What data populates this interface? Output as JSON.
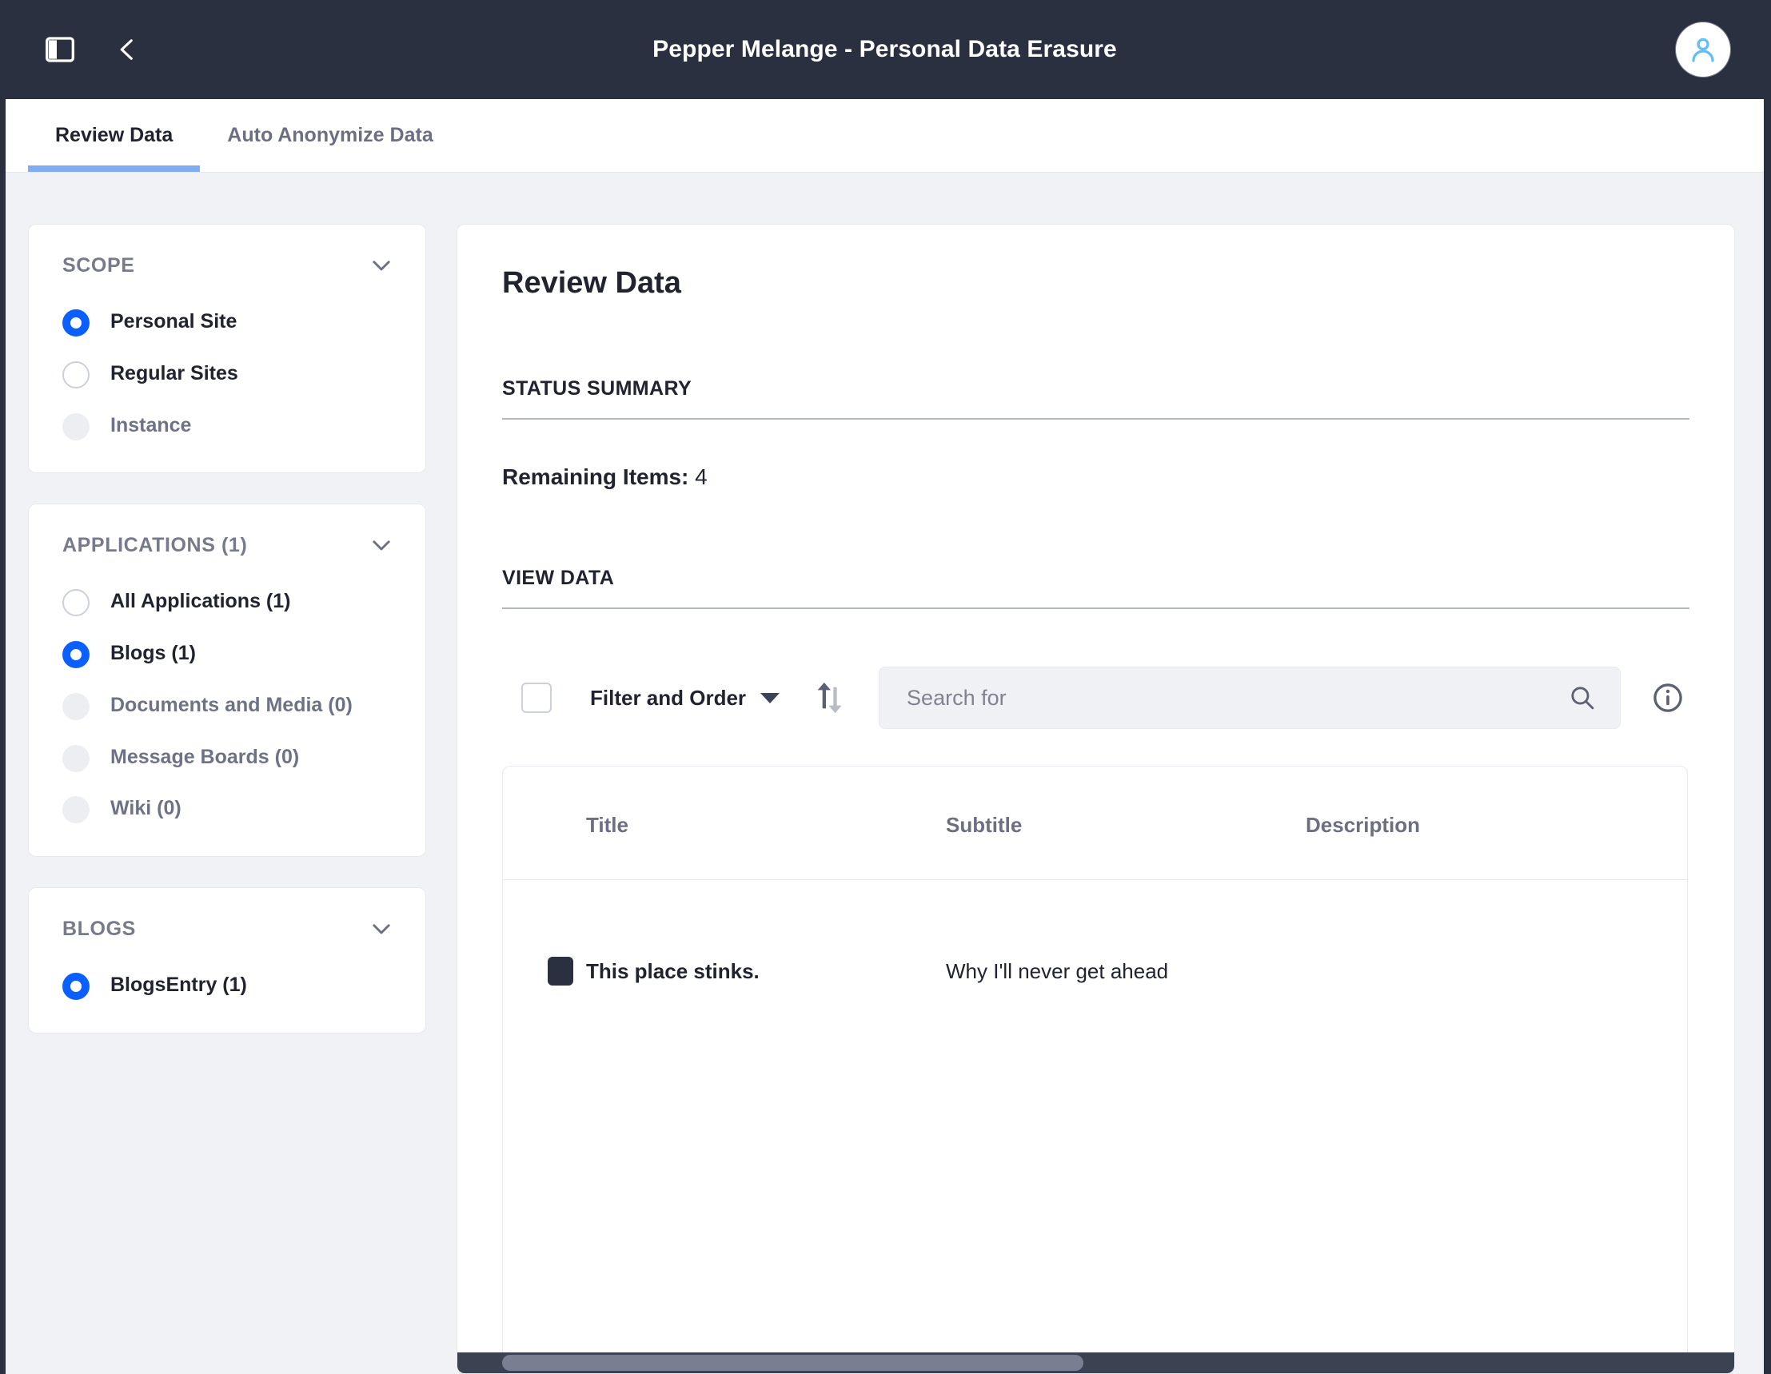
{
  "topbar": {
    "title": "Pepper Melange - Personal Data Erasure",
    "sidebar_toggle_icon": "sidebar-toggle-icon",
    "back_icon": "chevron-left-icon",
    "avatar_icon": "user-icon"
  },
  "tabs": [
    {
      "label": "Review Data",
      "active": true
    },
    {
      "label": "Auto Anonymize Data",
      "active": false
    }
  ],
  "sidebar": {
    "panels": [
      {
        "title": "SCOPE",
        "chevron_icon": "chevron-down-icon",
        "options": [
          {
            "label": "Personal Site",
            "state": "checked"
          },
          {
            "label": "Regular Sites",
            "state": "unchecked"
          },
          {
            "label": "Instance",
            "state": "disabled"
          }
        ]
      },
      {
        "title": "APPLICATIONS (1)",
        "chevron_icon": "chevron-down-icon",
        "options": [
          {
            "label": "All Applications (1)",
            "state": "unchecked"
          },
          {
            "label": "Blogs (1)",
            "state": "checked"
          },
          {
            "label": "Documents and Media (0)",
            "state": "disabled"
          },
          {
            "label": "Message Boards (0)",
            "state": "disabled"
          },
          {
            "label": "Wiki (0)",
            "state": "disabled"
          }
        ]
      },
      {
        "title": "BLOGS",
        "chevron_icon": "chevron-down-icon",
        "options": [
          {
            "label": "BlogsEntry (1)",
            "state": "checked"
          }
        ]
      }
    ]
  },
  "main": {
    "page_title": "Review Data",
    "status_summary_label": "STATUS SUMMARY",
    "remaining_items_label": "Remaining Items:",
    "remaining_items_value": "4",
    "view_data_label": "VIEW DATA",
    "toolbar": {
      "filter_label": "Filter and Order",
      "caret_icon": "caret-down-icon",
      "sort_icon": "sort-ascending-descending-icon",
      "search_placeholder": "Search for",
      "search_value": "",
      "search_icon": "search-icon",
      "info_icon": "info-circle-icon",
      "select_all_checkbox": "unchecked"
    },
    "table": {
      "columns": [
        "Title",
        "Subtitle",
        "Description"
      ],
      "rows": [
        {
          "selected": true,
          "title": "This place stinks.",
          "subtitle": "Why I'll never get ahead",
          "description": ""
        }
      ]
    }
  },
  "colors": {
    "topbar_bg": "#2b3040",
    "accent_blue": "#0b5fff",
    "tab_underline": "#80acf4",
    "page_bg": "#f1f2f5",
    "scrollbar_track": "#3b4251",
    "scrollbar_thumb": "#787f90"
  }
}
